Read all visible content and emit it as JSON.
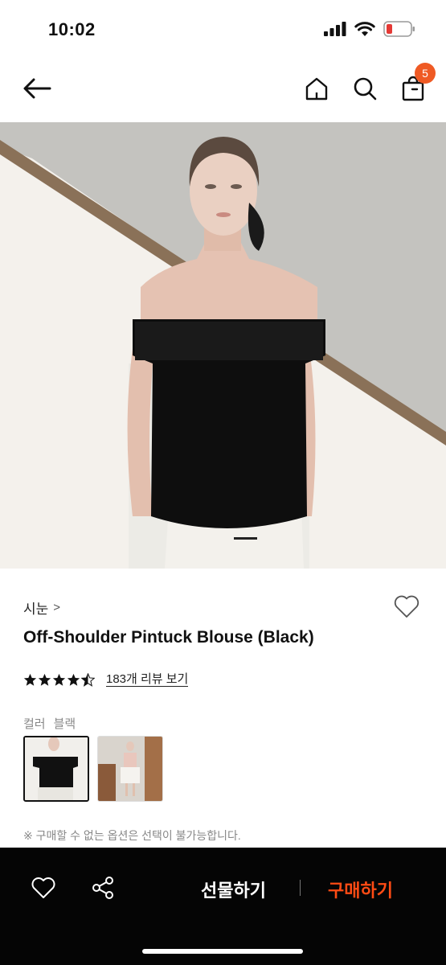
{
  "status": {
    "time": "10:02"
  },
  "header": {
    "cart_count": "5"
  },
  "product": {
    "brand": "시눈",
    "title": "Off-Shoulder Pintuck Blouse (Black)",
    "rating": 4.5,
    "review_link": "183개 리뷰 보기",
    "color_label": "컬러",
    "color_value": "블랙",
    "notice": "※ 구매할 수 없는 옵션은 선택이 불가능합니다."
  },
  "bottom_bar": {
    "gift_label": "선물하기",
    "buy_label": "구매하기"
  },
  "colors": {
    "accent": "#ef5a24",
    "buy": "#ff4b14",
    "bar_bg": "#050505"
  },
  "icons": [
    "back-arrow-icon",
    "home-icon",
    "search-icon",
    "cart-icon",
    "heart-icon",
    "share-icon",
    "star-icon",
    "chevron-right-icon"
  ]
}
